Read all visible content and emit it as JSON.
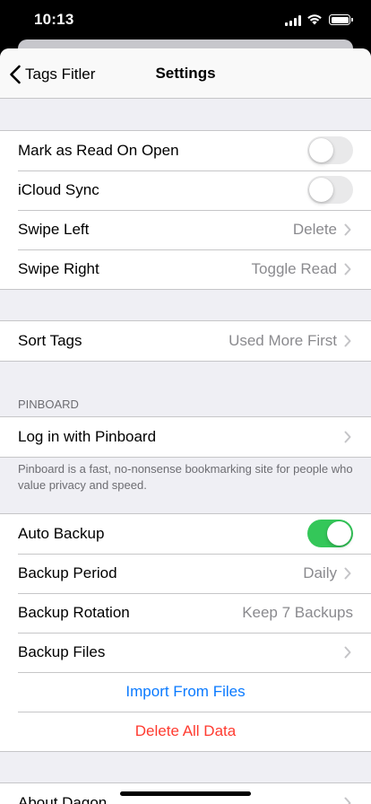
{
  "status_bar": {
    "time": "10:13"
  },
  "nav": {
    "back_label": "Tags Fitler",
    "title": "Settings"
  },
  "reading": {
    "mark_as_read": {
      "label": "Mark as Read On Open",
      "on": false
    },
    "icloud_sync": {
      "label": "iCloud Sync",
      "on": false
    },
    "swipe_left": {
      "label": "Swipe Left",
      "value": "Delete"
    },
    "swipe_right": {
      "label": "Swipe Right",
      "value": "Toggle Read"
    }
  },
  "sorting": {
    "sort_tags": {
      "label": "Sort Tags",
      "value": "Used More First"
    }
  },
  "pinboard": {
    "header": "PINBOARD",
    "login_label": "Log in with Pinboard",
    "footer": "Pinboard is a fast, no-nonsense bookmarking site for people who value privacy and speed."
  },
  "backup": {
    "auto_backup": {
      "label": "Auto Backup",
      "on": true
    },
    "period": {
      "label": "Backup Period",
      "value": "Daily"
    },
    "rotation": {
      "label": "Backup Rotation",
      "value": "Keep 7 Backups"
    },
    "files_label": "Backup Files",
    "import_label": "Import From Files",
    "delete_label": "Delete All Data"
  },
  "about": {
    "label": "About Dagon"
  },
  "colors": {
    "accent": "#0a7aff",
    "destructive": "#ff3b30",
    "toggle_on": "#34c759",
    "secondary_text": "#8a8a8e"
  }
}
